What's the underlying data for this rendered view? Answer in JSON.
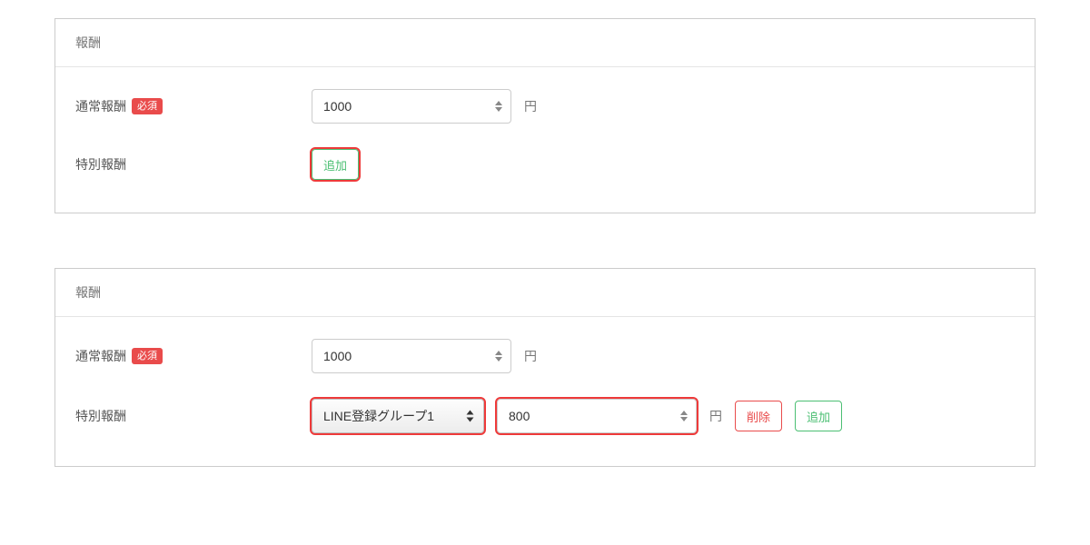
{
  "section1": {
    "title": "報酬",
    "normal": {
      "label": "通常報酬",
      "required_badge": "必須",
      "value": "1000",
      "unit": "円"
    },
    "special": {
      "label": "特別報酬",
      "add_button": "追加"
    }
  },
  "section2": {
    "title": "報酬",
    "normal": {
      "label": "通常報酬",
      "required_badge": "必須",
      "value": "1000",
      "unit": "円"
    },
    "special": {
      "label": "特別報酬",
      "group_select": "LINE登録グループ1",
      "value": "800",
      "unit": "円",
      "delete_button": "削除",
      "add_button": "追加"
    }
  }
}
